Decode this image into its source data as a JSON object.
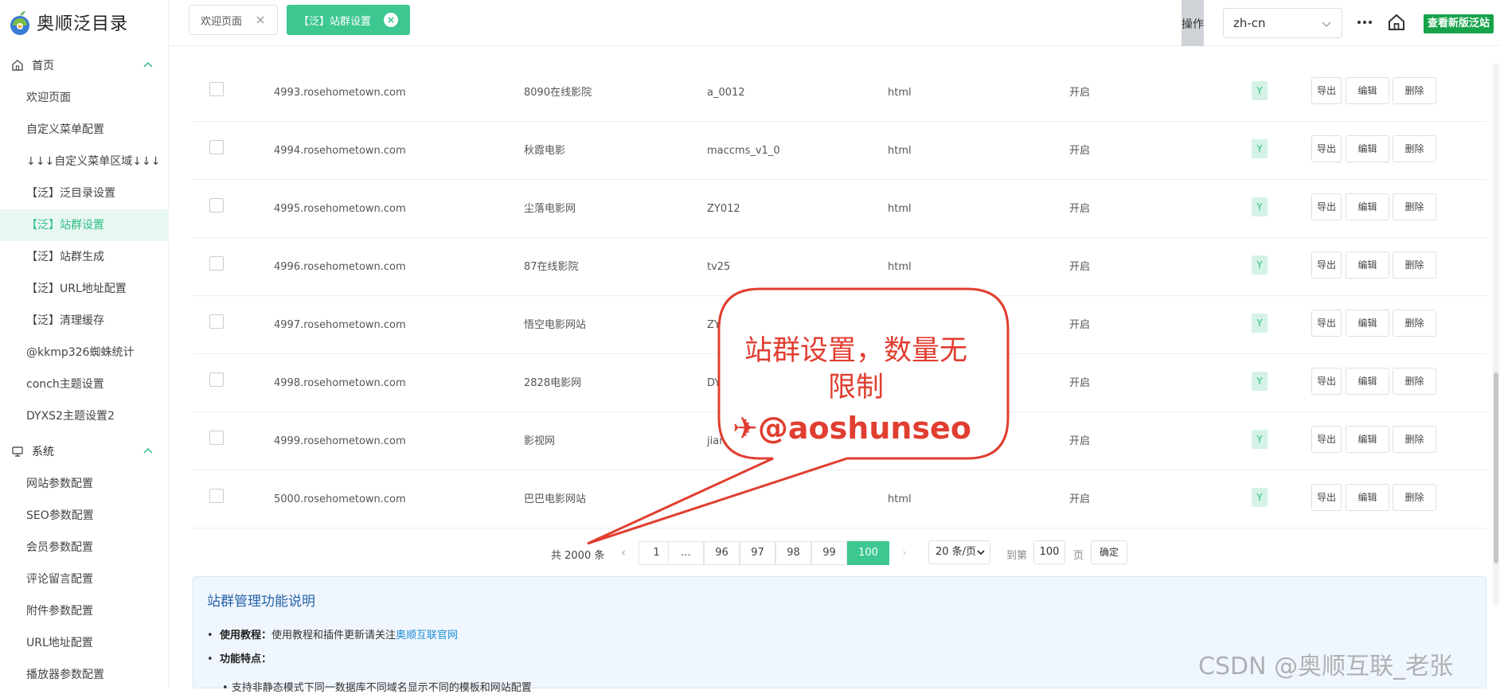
{
  "app": {
    "logo_text": "奥顺泛目录"
  },
  "sidebar": {
    "group_home": "首页",
    "home_items": [
      "欢迎页面",
      "自定义菜单配置",
      "↓↓↓自定义菜单区域↓↓↓",
      "【泛】泛目录设置",
      "【泛】站群设置",
      "【泛】站群生成",
      "【泛】URL地址配置",
      "【泛】清理缓存",
      "@kkmp326蜘蛛统计",
      "conch主题设置",
      "DYXS2主题设置2"
    ],
    "active_item": "【泛】站群设置",
    "group_system": "系统",
    "system_items": [
      "网站参数配置",
      "SEO参数配置",
      "会员参数配置",
      "评论留言配置",
      "附件参数配置",
      "URL地址配置",
      "播放器参数配置"
    ]
  },
  "header": {
    "tabs": [
      {
        "label": "欢迎页面"
      },
      {
        "label": "【泛】站群设置"
      }
    ],
    "op_label": "操作",
    "language": "zh-cn",
    "new_version_button": "查看新版泛站"
  },
  "table": {
    "rows": [
      {
        "domain": "4993.rosehometown.com",
        "name": "8090在线影院",
        "template": "a_0012",
        "type": "html",
        "status": "开启",
        "flag": "Y"
      },
      {
        "domain": "4994.rosehometown.com",
        "name": "秋霞电影",
        "template": "maccms_v1_0",
        "type": "html",
        "status": "开启",
        "flag": "Y"
      },
      {
        "domain": "4995.rosehometown.com",
        "name": "尘落电影网",
        "template": "ZY012",
        "type": "html",
        "status": "开启",
        "flag": "Y"
      },
      {
        "domain": "4996.rosehometown.com",
        "name": "87在线影院",
        "template": "tv25",
        "type": "html",
        "status": "开启",
        "flag": "Y"
      },
      {
        "domain": "4997.rosehometown.com",
        "name": "悟空电影网站",
        "template": "ZY",
        "type": "html",
        "status": "开启",
        "flag": "Y"
      },
      {
        "domain": "4998.rosehometown.com",
        "name": "2828电影网",
        "template": "DY",
        "type": "html",
        "status": "开启",
        "flag": "Y"
      },
      {
        "domain": "4999.rosehometown.com",
        "name": "影视网",
        "template": "jian",
        "type": "html",
        "status": "开启",
        "flag": "Y"
      },
      {
        "domain": "5000.rosehometown.com",
        "name": "巴巴电影网站",
        "template": "",
        "type": "html",
        "status": "开启",
        "flag": "Y"
      }
    ],
    "actions": {
      "export": "导出",
      "edit": "编辑",
      "delete": "删除"
    }
  },
  "pagination": {
    "total": "共 2000 条",
    "pages": [
      "1",
      "...",
      "96",
      "97",
      "98",
      "99",
      "100"
    ],
    "current": "100",
    "page_size": "20 条/页",
    "goto_label": "到第",
    "goto_value": "100",
    "page_unit": "页",
    "confirm": "确定"
  },
  "info": {
    "title": "站群管理功能说明",
    "tutorial_label": "使用教程：",
    "tutorial_text": "使用教程和插件更新请关注",
    "tutorial_link": "奥顺互联官网",
    "features_label": "功能特点：",
    "feature_1": "• 支持非静态模式下同一数据库不同域名显示不同的模板和网站配置"
  },
  "callout": {
    "line1": "站群设置，数量无",
    "line2": "限制",
    "handle": "✈@aoshunseo"
  },
  "watermark": "CSDN @奥顺互联_老张",
  "colors": {
    "accent": "#3dc791",
    "callout": "#e03e30",
    "new_button": "#16a34a"
  }
}
